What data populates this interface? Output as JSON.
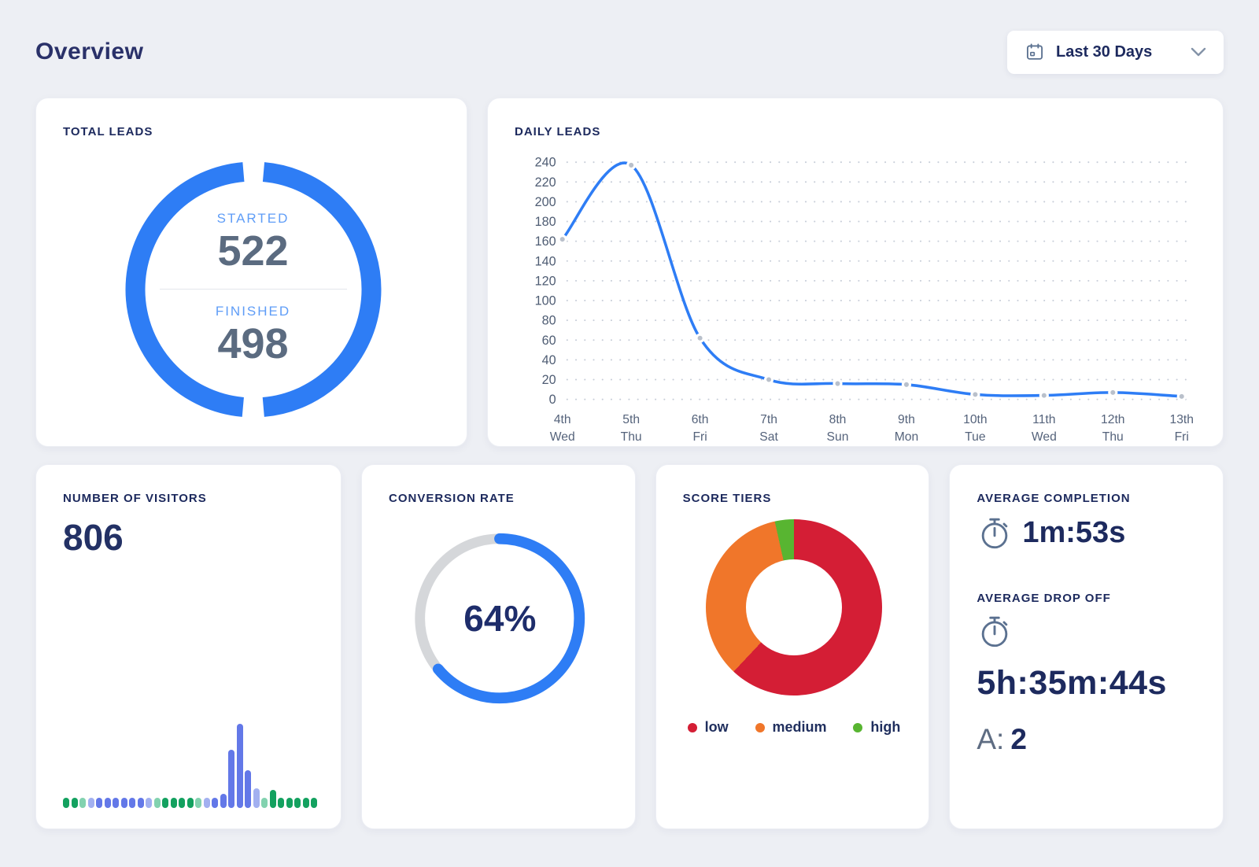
{
  "page": {
    "title": "Overview"
  },
  "date_filter": {
    "label": "Last 30 Days"
  },
  "colors": {
    "accent_blue": "#2e7df5",
    "track_gray": "#d5d7da",
    "navy": "#1d2a5e",
    "slate": "#5b6b80",
    "light_blue_label": "#5f9df7",
    "marker_gray": "#b9c0cb",
    "red": "#d41e35",
    "orange": "#f0762a",
    "green": "#58b531",
    "bar_green": "#13a15f",
    "bar_mint": "#82d2af",
    "bar_periwinkle": "#a2b0f0",
    "bar_blue": "#6378e8",
    "icon_slate": "#5b7190"
  },
  "cards": {
    "total_leads": {
      "title": "TOTAL LEADS",
      "started_label": "STARTED",
      "started_value": "522",
      "finished_label": "FINISHED",
      "finished_value": "498"
    },
    "daily_leads": {
      "title": "DAILY LEADS"
    },
    "visitors": {
      "title": "NUMBER OF VISITORS",
      "value": "806"
    },
    "conversion": {
      "title": "CONVERSION RATE",
      "value": "64%"
    },
    "score_tiers": {
      "title": "SCORE TIERS",
      "legend": [
        {
          "label": "low",
          "color": "#d41e35"
        },
        {
          "label": "medium",
          "color": "#f0762a"
        },
        {
          "label": "high",
          "color": "#58b531"
        }
      ]
    },
    "averages": {
      "completion_title": "AVERAGE COMPLETION",
      "completion_value": "1m:53s",
      "dropoff_title": "AVERAGE DROP OFF",
      "dropoff_value": "5h:35m:44s",
      "a_label": "A:",
      "a_value": "2"
    }
  },
  "chart_data": [
    {
      "id": "daily-leads",
      "type": "line",
      "title": "DAILY LEADS",
      "x": [
        [
          "4th",
          "Wed"
        ],
        [
          "5th",
          "Thu"
        ],
        [
          "6th",
          "Fri"
        ],
        [
          "7th",
          "Sat"
        ],
        [
          "8th",
          "Sun"
        ],
        [
          "9th",
          "Mon"
        ],
        [
          "10th",
          "Tue"
        ],
        [
          "11th",
          "Wed"
        ],
        [
          "12th",
          "Thu"
        ],
        [
          "13th",
          "Fri"
        ]
      ],
      "values": [
        162,
        237,
        62,
        20,
        16,
        15,
        5,
        4,
        7,
        3
      ],
      "ylim": [
        0,
        240
      ],
      "ytick_step": 20,
      "grid": "dotted",
      "line_color": "#2e7df5",
      "marker_color": "#b9c0cb"
    },
    {
      "id": "total-leads-ring",
      "type": "donut",
      "title": "TOTAL LEADS",
      "segments": [
        {
          "name": "half-a",
          "value": 50
        },
        {
          "name": "half-b",
          "value": 50
        }
      ],
      "color": "#2e7df5",
      "annotations": {
        "started": 522,
        "finished": 498
      }
    },
    {
      "id": "visitors-bars",
      "type": "bar",
      "title": "NUMBER OF VISITORS",
      "total": 806,
      "heights": [
        13,
        13,
        13,
        13,
        13,
        13,
        13,
        13,
        13,
        13,
        13,
        13,
        13,
        13,
        13,
        13,
        13,
        13,
        13,
        18,
        74,
        107,
        48,
        25,
        13,
        23,
        13,
        13,
        13,
        13,
        13
      ],
      "bar_colors": [
        "green",
        "green",
        "mint",
        "peri",
        "blue",
        "blue",
        "blue",
        "blue",
        "blue",
        "blue",
        "peri",
        "mint",
        "green",
        "green",
        "green",
        "green",
        "mint",
        "peri",
        "blue",
        "blue",
        "blue",
        "blue",
        "blue",
        "peri",
        "mint",
        "green",
        "green",
        "green",
        "green",
        "green",
        "green"
      ],
      "palette": {
        "green": "#13a15f",
        "mint": "#82d2af",
        "peri": "#a2b0f0",
        "blue": "#6378e8"
      }
    },
    {
      "id": "conversion-ring",
      "type": "donut-progress",
      "title": "CONVERSION RATE",
      "percent": 64,
      "color": "#2e7df5",
      "track_color": "#d5d7da"
    },
    {
      "id": "score-tiers",
      "type": "donut",
      "title": "SCORE TIERS",
      "slices": [
        {
          "label": "low",
          "value": 62.0,
          "color": "#d41e35"
        },
        {
          "label": "medium",
          "value": 34.5,
          "color": "#f0762a"
        },
        {
          "label": "high",
          "value": 3.5,
          "color": "#58b531"
        }
      ],
      "legend_position": "bottom"
    }
  ]
}
